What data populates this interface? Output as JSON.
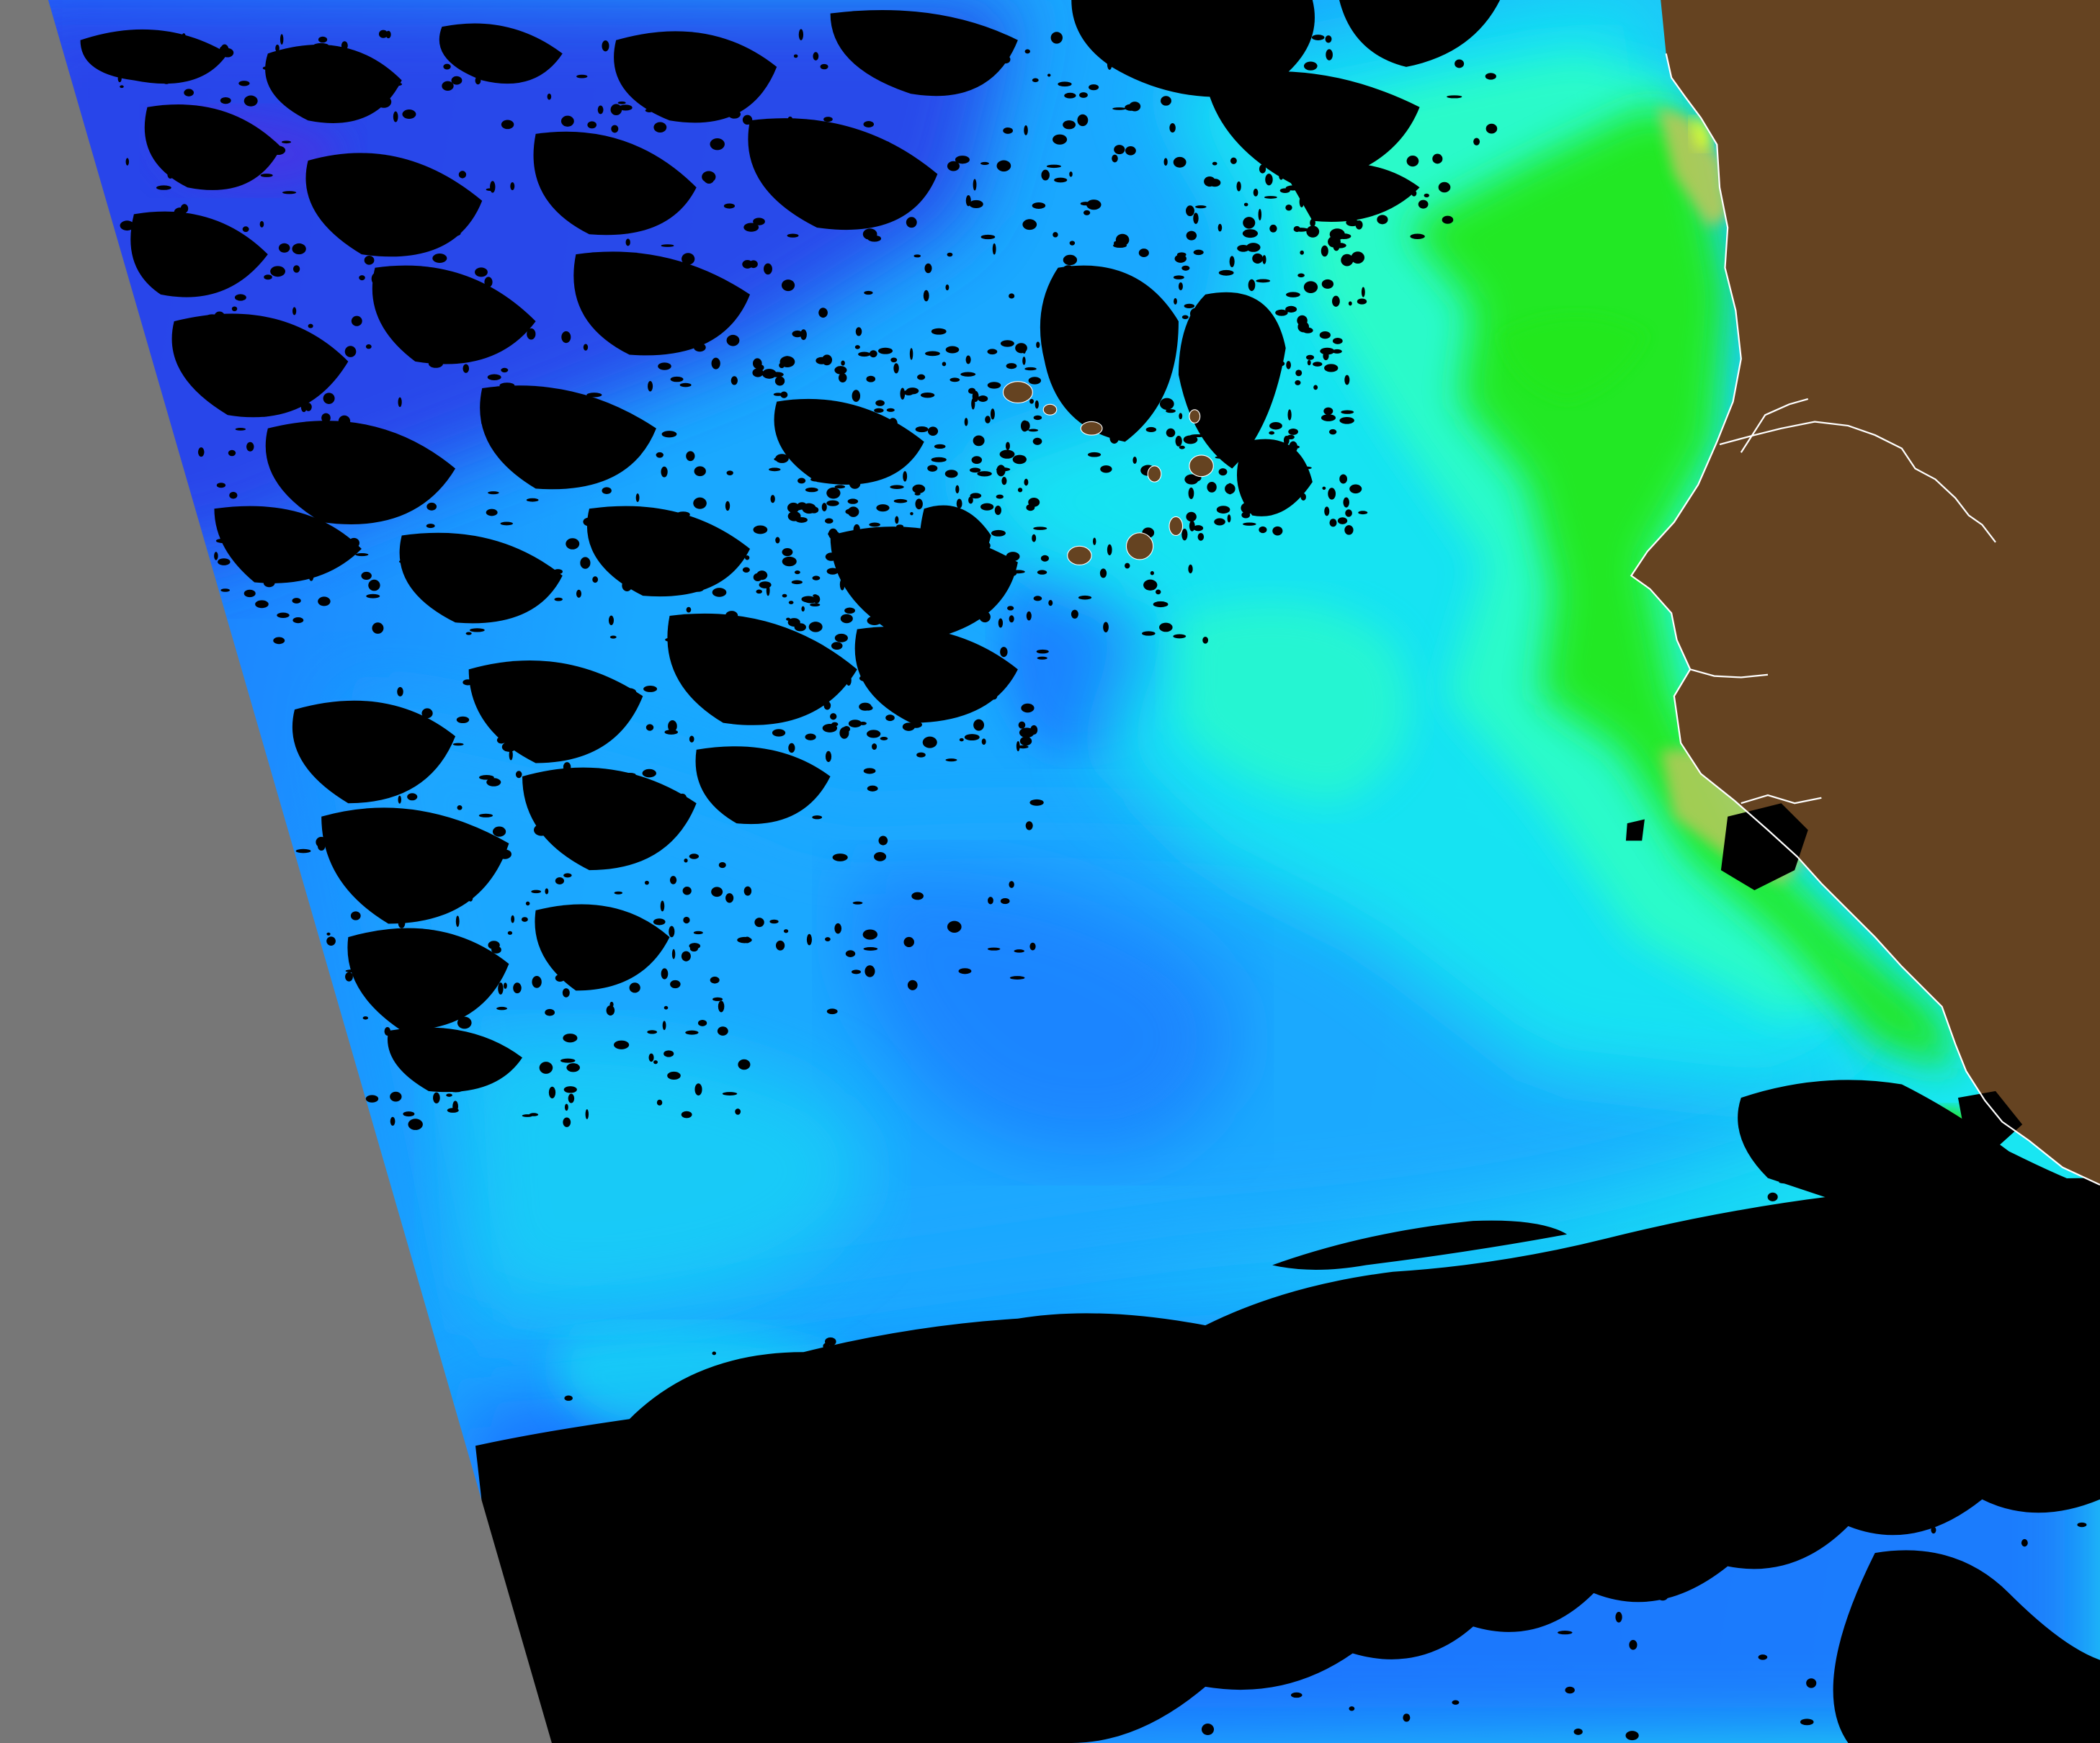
{
  "map": {
    "colors": {
      "no_data_swath": "#777777",
      "land": "#654321",
      "cloud_mask": "#000000",
      "coastline_and_rivers": "#FFFFFF",
      "ocean_low_deep_blue": "#2B40E8",
      "ocean_low_blue": "#1E6BFF",
      "ocean_mid_azure": "#1AA8FF",
      "ocean_mid_cyan": "#19E6F2",
      "ocean_high_aquamarine": "#2EFFC2",
      "ocean_high_green": "#22E81E",
      "ocean_peak_yellow": "#E6FF2A",
      "ocean_low_violet": "#5A2CE0",
      "coastal_olive": "#B7C85A"
    }
  }
}
